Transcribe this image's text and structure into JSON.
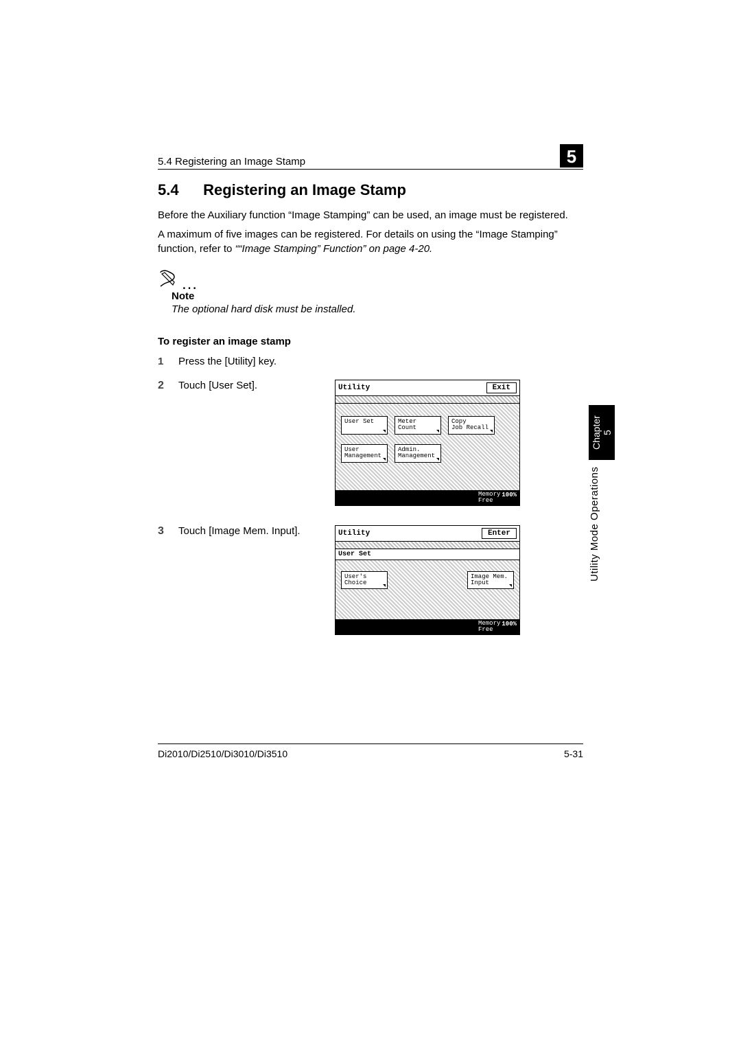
{
  "header": {
    "running_head": "5.4 Registering an Image Stamp",
    "chapter_box": "5"
  },
  "section": {
    "number": "5.4",
    "title": "Registering an Image Stamp",
    "para1": "Before the Auxiliary function “Image Stamping” can be used, an image must be registered.",
    "para2a": "A maximum of five images can be registered. For details on using the “Image Stamping” function, refer to ",
    "para2b": "““Image Stamping” Function” on page 4-20.",
    "note_dots": "…",
    "note_label": "Note",
    "note_text": "The optional hard disk must be installed.",
    "procedure_head": "To register an image stamp"
  },
  "steps": {
    "s1n": "1",
    "s1t": "Press the [Utility] key.",
    "s2n": "2",
    "s2t": "Touch [User Set].",
    "s3n": "3",
    "s3t": "Touch [Image Mem. Input]."
  },
  "screen1": {
    "title": "Utility",
    "exit": "Exit",
    "btn1": "User Set",
    "btn2_l1": "Meter",
    "btn2_l2": "Count",
    "btn3_l1": "Copy",
    "btn3_l2": "Job Recall",
    "btn4_l1": "User",
    "btn4_l2": "Management",
    "btn5_l1": "Admin.",
    "btn5_l2": "Management",
    "mem_l1": "Memory",
    "mem_l2": "Free",
    "mem_pct": "100%"
  },
  "screen2": {
    "title": "Utility",
    "enter": "Enter",
    "crumb": "User Set",
    "btn1_l1": "User's",
    "btn1_l2": "Choice",
    "btn2_l1": "Image Mem.",
    "btn2_l2": "Input",
    "mem_l1": "Memory",
    "mem_l2": "Free",
    "mem_pct": "100%"
  },
  "side": {
    "black": "Chapter 5",
    "white": "Utility Mode Operations"
  },
  "footer": {
    "model": "Di2010/Di2510/Di3010/Di3510",
    "page": "5-31"
  }
}
